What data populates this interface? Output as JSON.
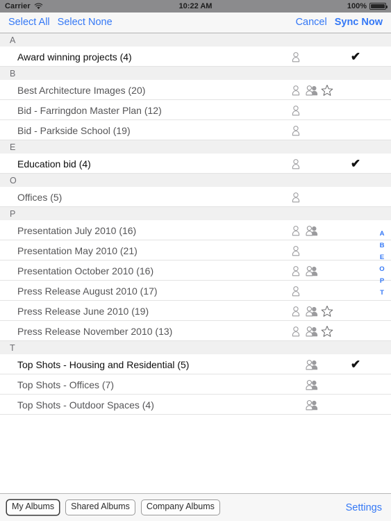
{
  "status_bar": {
    "carrier": "Carrier",
    "wifi_icon": "wifi-icon",
    "time": "10:22 AM",
    "battery_percent": "100%",
    "battery_icon": "battery-icon"
  },
  "nav_bar": {
    "select_all": "Select All",
    "select_none": "Select None",
    "cancel": "Cancel",
    "sync_now": "Sync Now",
    "accent_color": "#3478f6"
  },
  "section_index": {
    "letters": [
      "A",
      "B",
      "E",
      "O",
      "P",
      "T"
    ],
    "color": "#3478f6"
  },
  "list": {
    "sections": [
      {
        "letter": "A",
        "rows": [
          {
            "title": "Award winning projects (4)",
            "person": true,
            "group": false,
            "star": false,
            "selected": true,
            "check": "✔"
          }
        ]
      },
      {
        "letter": "B",
        "rows": [
          {
            "title": "Best Architecture Images (20)",
            "person": true,
            "group": true,
            "star": true,
            "selected": false,
            "check": ""
          },
          {
            "title": "Bid - Farringdon Master Plan (12)",
            "person": true,
            "group": false,
            "star": false,
            "selected": false,
            "check": ""
          },
          {
            "title": "Bid - Parkside School (19)",
            "person": true,
            "group": false,
            "star": false,
            "selected": false,
            "check": ""
          }
        ]
      },
      {
        "letter": "E",
        "rows": [
          {
            "title": "Education bid (4)",
            "person": true,
            "group": false,
            "star": false,
            "selected": true,
            "check": "✔"
          }
        ]
      },
      {
        "letter": "O",
        "rows": [
          {
            "title": "Offices (5)",
            "person": true,
            "group": false,
            "star": false,
            "selected": false,
            "check": ""
          }
        ]
      },
      {
        "letter": "P",
        "rows": [
          {
            "title": "Presentation July 2010 (16)",
            "person": true,
            "group": true,
            "star": false,
            "selected": false,
            "check": ""
          },
          {
            "title": "Presentation May 2010 (21)",
            "person": true,
            "group": false,
            "star": false,
            "selected": false,
            "check": ""
          },
          {
            "title": "Presentation October 2010 (16)",
            "person": true,
            "group": true,
            "star": false,
            "selected": false,
            "check": ""
          },
          {
            "title": "Press Release August 2010 (17)",
            "person": true,
            "group": false,
            "star": false,
            "selected": false,
            "check": ""
          },
          {
            "title": "Press Release June 2010 (19)",
            "person": true,
            "group": true,
            "star": true,
            "selected": false,
            "check": ""
          },
          {
            "title": "Press Release November 2010 (13)",
            "person": true,
            "group": true,
            "star": true,
            "selected": false,
            "check": ""
          }
        ]
      },
      {
        "letter": "T",
        "rows": [
          {
            "title": "Top Shots - Housing and Residential (5)",
            "person": false,
            "group": true,
            "star": false,
            "selected": true,
            "check": "✔"
          },
          {
            "title": "Top Shots - Offices (7)",
            "person": false,
            "group": true,
            "star": false,
            "selected": false,
            "check": ""
          },
          {
            "title": "Top Shots - Outdoor Spaces (4)",
            "person": false,
            "group": true,
            "star": false,
            "selected": false,
            "check": ""
          }
        ]
      }
    ]
  },
  "toolbar": {
    "buttons": [
      {
        "label": "My Albums",
        "active": true
      },
      {
        "label": "Shared Albums",
        "active": false
      },
      {
        "label": "Company Albums",
        "active": false
      }
    ],
    "settings": "Settings"
  }
}
